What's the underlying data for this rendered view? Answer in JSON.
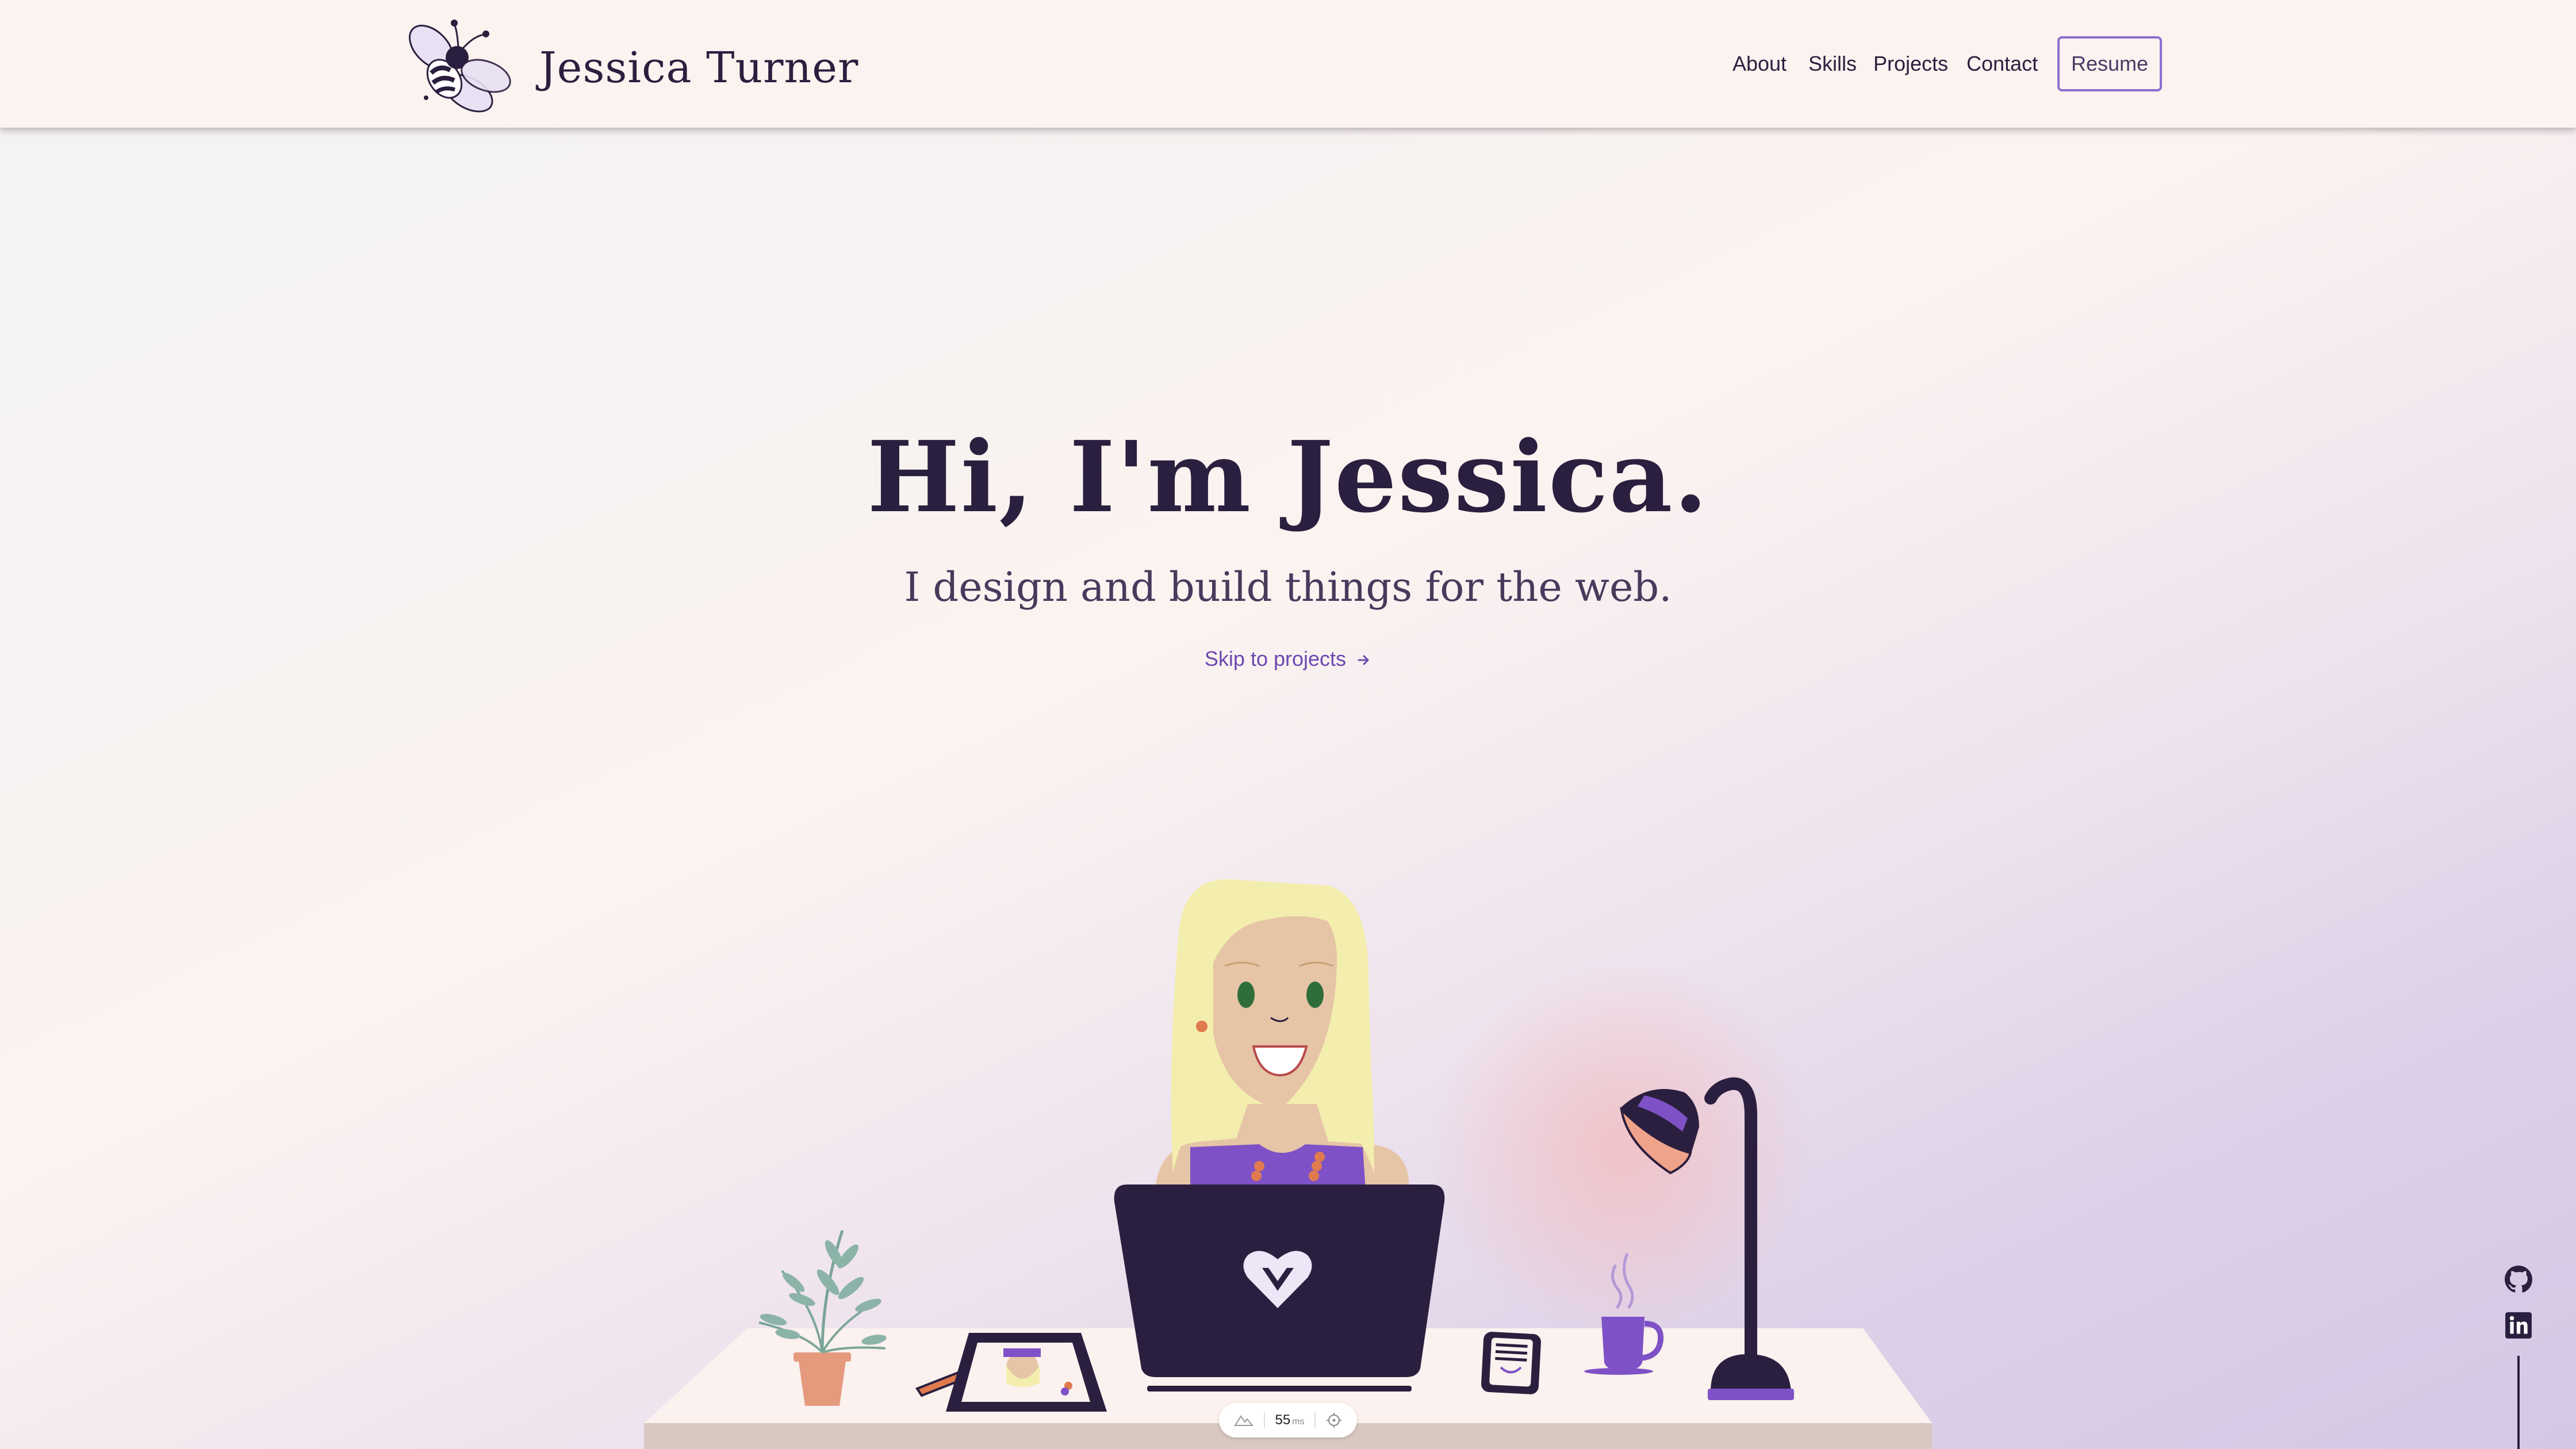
{
  "header": {
    "brand_name": "Jessica Turner",
    "logo_icon": "bee-icon",
    "nav": [
      {
        "label": "About"
      },
      {
        "label": "Skills"
      },
      {
        "label": "Projects"
      },
      {
        "label": "Contact"
      }
    ],
    "resume_label": "Resume"
  },
  "hero": {
    "title": "Hi, I'm Jessica.",
    "subtitle": "I design and build things for the web.",
    "skip_link": "Skip to projects",
    "skip_icon": "arrow-right-icon"
  },
  "illustration": {
    "icons": [
      "plant-icon",
      "pencil-icon",
      "tablet-icon",
      "laptop-icon",
      "heart-v-logo-icon",
      "phone-icon",
      "mug-icon",
      "desk-lamp-icon"
    ]
  },
  "social": {
    "icons": [
      "github-icon",
      "linkedin-icon"
    ]
  },
  "perf_widget": {
    "value": "55",
    "unit": "ms"
  },
  "colors": {
    "primary": "#2b1f3f",
    "accent": "#8e6ecf",
    "link": "#6d48b0",
    "header_bg": "#fcf2ef",
    "laptop": "#2b1f3f",
    "desk": "#fbf1ee"
  }
}
